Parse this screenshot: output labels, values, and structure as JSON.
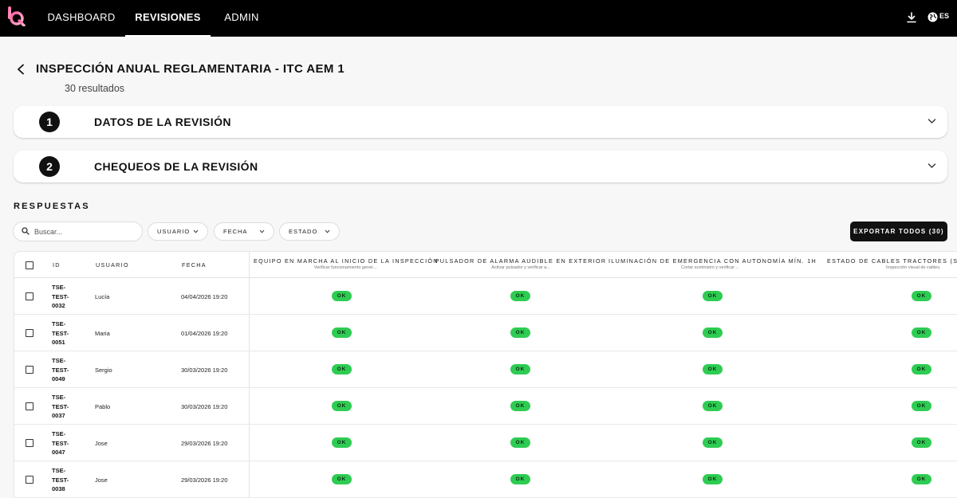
{
  "nav": {
    "brand_icon": "brand-logo-icon",
    "tabs": [
      {
        "label": "DASHBOARD",
        "active": false
      },
      {
        "label": "REVISIONES",
        "active": true
      },
      {
        "label": "ADMIN",
        "active": false
      }
    ],
    "download_icon": "download-icon",
    "language_icon": "globe-icon",
    "language": "ES"
  },
  "header": {
    "back_icon": "chevron-left-icon",
    "title": "INSPECCIÓN ANUAL REGLAMENTARIA - ITC AEM 1",
    "results": "30 resultados"
  },
  "sections": [
    {
      "number": "1",
      "title": "DATOS DE LA REVISIÓN",
      "expanded": false
    },
    {
      "number": "2",
      "title": "CHEQUEOS DE LA REVISIÓN",
      "expanded": false
    }
  ],
  "responses": {
    "label": "RESPUESTAS",
    "search_placeholder": "Buscar...",
    "filters": [
      "USUARIO",
      "FECHA",
      "ESTADO"
    ],
    "export_label": "EXPORTAR TODOS (30)"
  },
  "table": {
    "columns": {
      "id": "ID",
      "user": "USUARIO",
      "date": "FECHA",
      "checks": [
        {
          "title": "EQUIPO EN MARCHA AL INICIO DE LA INSPECCIÓN",
          "subtitle": "Verificar funcionamiento gener..."
        },
        {
          "title": "PULSADOR DE ALARMA AUDIBLE EN EXTERIOR",
          "subtitle": "Activar pulsador y verificar a..."
        },
        {
          "title": "ILUMINACIÓN DE EMERGENCIA CON AUTONOMÍA MÍN. 1H",
          "subtitle": "Cortar suministro y verificar ..."
        },
        {
          "title": "ESTADO DE CABLES TRACTORES (SIN",
          "subtitle": "Inspección visual de cables,"
        }
      ]
    },
    "rows": [
      {
        "id": "TSE-TEST-0032",
        "user": "Lucía",
        "date": "04/04/2026 19:20",
        "results": [
          "OK",
          "OK",
          "OK",
          "OK"
        ]
      },
      {
        "id": "TSE-TEST-0051",
        "user": "Maria",
        "date": "01/04/2026 19:20",
        "results": [
          "OK",
          "OK",
          "OK",
          "OK"
        ]
      },
      {
        "id": "TSE-TEST-0049",
        "user": "Sergio",
        "date": "30/03/2026 19:20",
        "results": [
          "OK",
          "OK",
          "OK",
          "OK"
        ]
      },
      {
        "id": "TSE-TEST-0037",
        "user": "Pablo",
        "date": "30/03/2026 19:20",
        "results": [
          "OK",
          "OK",
          "OK",
          "OK"
        ]
      },
      {
        "id": "TSE-TEST-0047",
        "user": "Jose",
        "date": "29/03/2026 19:20",
        "results": [
          "OK",
          "OK",
          "OK",
          "OK"
        ]
      },
      {
        "id": "TSE-TEST-0038",
        "user": "Jose",
        "date": "29/03/2026 19:20",
        "results": [
          "OK",
          "OK",
          "OK",
          "OK"
        ]
      }
    ]
  },
  "colors": {
    "topbar": "#000000",
    "ok_badge": "#2ecc52",
    "export_button": "#111111"
  }
}
